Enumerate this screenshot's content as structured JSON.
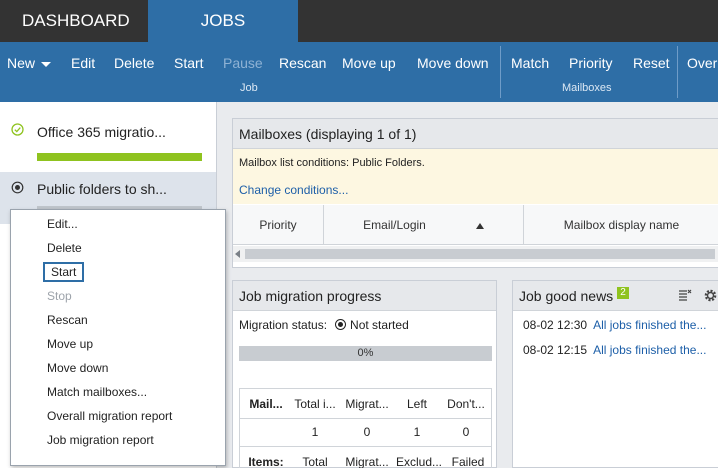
{
  "top_tabs": {
    "dashboard": "DASHBOARD",
    "jobs": "JOBS"
  },
  "ribbon": {
    "new": "New",
    "edit": "Edit",
    "delete": "Delete",
    "start": "Start",
    "pause": "Pause",
    "rescan": "Rescan",
    "move_up": "Move up",
    "move_down": "Move down",
    "job_group": "Job",
    "match": "Match",
    "priority": "Priority",
    "reset": "Reset",
    "overflow": "Over",
    "mailboxes_group": "Mailboxes"
  },
  "jobs": [
    {
      "name": "Office 365 migratio...",
      "status_icon": "check-circle-icon",
      "progress": 1.0,
      "color": "#8fc31f"
    },
    {
      "name": "Public folders to sh...",
      "status_icon": "radio-dot-icon"
    }
  ],
  "context_menu": {
    "edit": "Edit...",
    "delete": "Delete",
    "start": "Start",
    "stop": "Stop",
    "rescan": "Rescan",
    "move_up": "Move up",
    "move_down": "Move down",
    "match_mailboxes": "Match mailboxes...",
    "overall_report": "Overall migration report",
    "job_report": "Job migration report"
  },
  "mailboxes": {
    "title": "Mailboxes (displaying 1 of 1)",
    "conditions": "Mailbox list conditions: Public Folders.",
    "change_link": "Change conditions...",
    "columns": [
      "Priority",
      "Email/Login",
      "Mailbox display name"
    ]
  },
  "progress": {
    "title": "Job migration progress",
    "status_label": "Migration status:",
    "status_value": "Not started",
    "percent": "0%",
    "headers": [
      "Mail...",
      "Total i...",
      "Migrat...",
      "Left",
      "Don't..."
    ],
    "values": [
      "1",
      "0",
      "1",
      "0"
    ],
    "item_row": [
      "Items:",
      "Total",
      "Migrat...",
      "Exclud...",
      "Failed"
    ]
  },
  "good_news": {
    "title": "Job good news",
    "count": "2",
    "entries": [
      {
        "time": "08-02 12:30",
        "message": "All jobs finished the..."
      },
      {
        "time": "08-02 12:15",
        "message": "All jobs finished the..."
      }
    ]
  },
  "colors": {
    "accent": "#2e6ea6",
    "topbar": "#333333",
    "success": "#8fc31f",
    "link": "#1d5fa8"
  }
}
